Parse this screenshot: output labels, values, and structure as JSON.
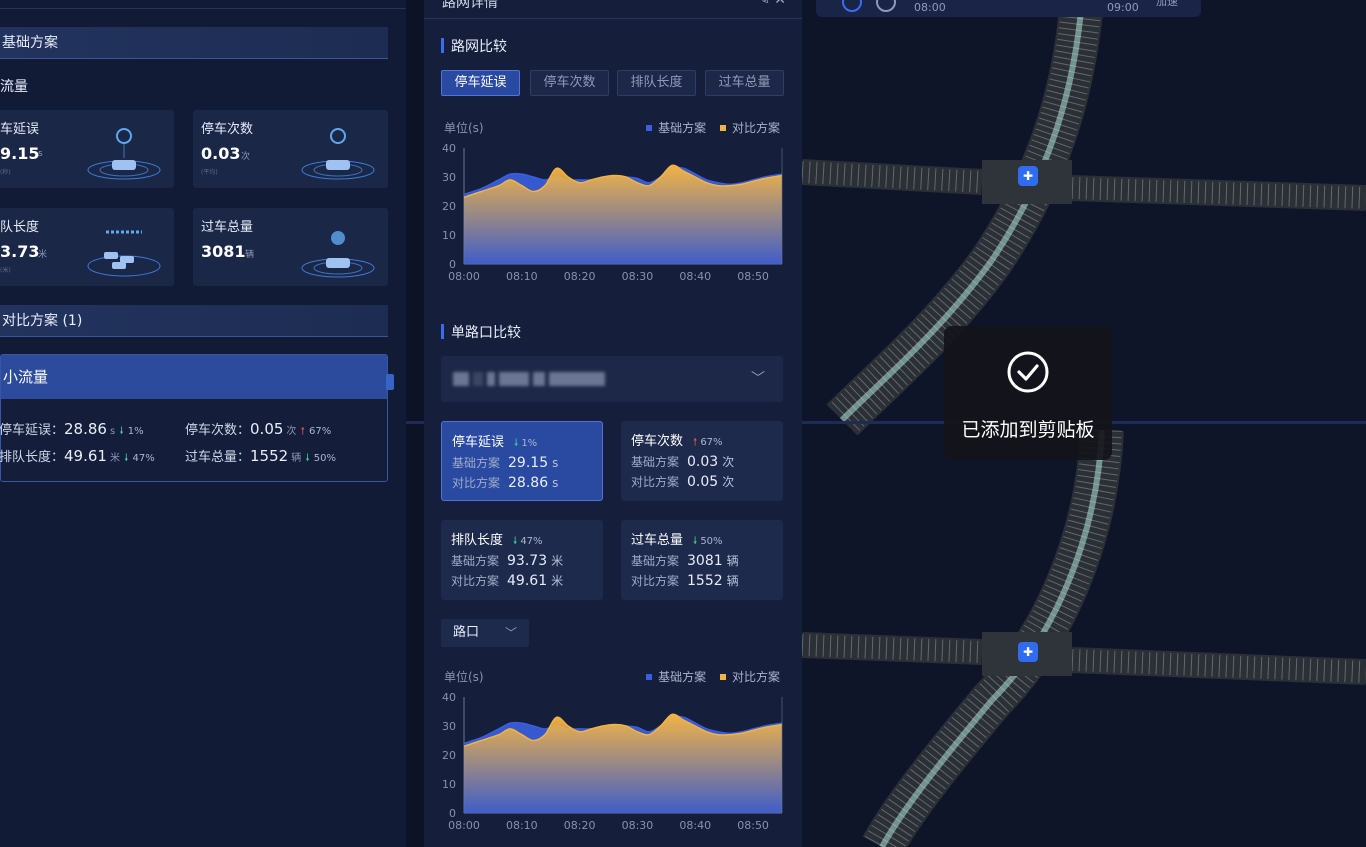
{
  "left_panel": {
    "base_section_title": "基础方案",
    "flow_title": "流量",
    "metrics": [
      {
        "label": "车延误",
        "value": "9.15",
        "unit": "s",
        "tiny": "(秒)"
      },
      {
        "label": "停车次数",
        "value": "0.03",
        "unit": "次",
        "tiny": "(平均)"
      },
      {
        "label": "队长度",
        "value": "3.73",
        "unit": "米",
        "tiny": "(米)"
      },
      {
        "label": "过车总量",
        "value": "3081",
        "unit": "辆",
        "tiny": ""
      }
    ],
    "compare_section_title": "对比方案 (1)",
    "plan_card": {
      "name": "小流量",
      "rows": [
        [
          {
            "label": "停车延误：",
            "value": "28.86",
            "unit": "s",
            "trend": "down",
            "pct": "1%"
          },
          {
            "label": "停车次数：",
            "value": "0.05",
            "unit": "次",
            "trend": "up",
            "pct": "67%"
          }
        ],
        [
          {
            "label": "排队长度：",
            "value": "49.61",
            "unit": "米",
            "trend": "down",
            "pct": "47%"
          },
          {
            "label": "过车总量：",
            "value": "1552",
            "unit": "辆",
            "trend": "down",
            "pct": "50%"
          }
        ]
      ]
    }
  },
  "mid_panel": {
    "header_title": "路网详情",
    "header_icons": "✎  ✕",
    "network_title": "路网比较",
    "tabs": [
      "停车延误",
      "停车次数",
      "排队长度",
      "过车总量"
    ],
    "active_tab": 0,
    "chart_unit": "单位(s)",
    "legend_base": "基础方案",
    "legend_compare": "对比方案",
    "single_title": "单路口比较",
    "compare_cards": [
      {
        "title": "停车延误",
        "trend": "down",
        "pct": "1%",
        "base_label": "基础方案",
        "base_value": "29.15",
        "base_unit": "s",
        "cmp_label": "对比方案",
        "cmp_value": "28.86",
        "cmp_unit": "s",
        "active": true
      },
      {
        "title": "停车次数",
        "trend": "up",
        "pct": "67%",
        "base_label": "基础方案",
        "base_value": "0.03",
        "base_unit": "次",
        "cmp_label": "对比方案",
        "cmp_value": "0.05",
        "cmp_unit": "次",
        "active": false
      },
      {
        "title": "排队长度",
        "trend": "down",
        "pct": "47%",
        "base_label": "基础方案",
        "base_value": "93.73",
        "base_unit": "米",
        "cmp_label": "对比方案",
        "cmp_value": "49.61",
        "cmp_unit": "米",
        "active": false
      },
      {
        "title": "过车总量",
        "trend": "down",
        "pct": "50%",
        "base_label": "基础方案",
        "base_value": "3081",
        "base_unit": "辆",
        "cmp_label": "对比方案",
        "cmp_value": "1552",
        "cmp_unit": "辆",
        "active": false
      }
    ],
    "junction_select": "路口"
  },
  "timeline": {
    "start": "08:00",
    "end": "09:00",
    "tail": "加速"
  },
  "toast": {
    "text": "已添加到剪贴板"
  },
  "colors": {
    "base": "#3a5fe0",
    "compare": "#f2b345",
    "accent": "#3a6cf0",
    "down": "#3fcf9a",
    "up": "#e0524e"
  },
  "chart_data": [
    {
      "type": "area",
      "title": "",
      "ylabel": "单位(s)",
      "xlabel": "",
      "x_ticks": [
        "08:00",
        "08:10",
        "08:20",
        "08:30",
        "08:40",
        "08:50"
      ],
      "y_ticks": [
        0,
        10,
        20,
        30,
        40
      ],
      "ylim": [
        0,
        40
      ],
      "x": [
        0,
        3,
        6,
        8,
        10,
        12,
        14,
        16,
        18,
        20,
        22,
        24,
        26,
        28,
        30,
        32,
        34,
        36,
        38,
        40,
        42,
        44,
        46,
        48,
        50,
        52,
        55
      ],
      "series": [
        {
          "name": "基础方案",
          "values": [
            24,
            26,
            29,
            31,
            31,
            30,
            29,
            30,
            29,
            29,
            29,
            29.5,
            30,
            30,
            29.5,
            28,
            30,
            33,
            33,
            31,
            29,
            28,
            27.5,
            28,
            29,
            30,
            31
          ]
        },
        {
          "name": "对比方案",
          "values": [
            23,
            25,
            27,
            29,
            27,
            25,
            27,
            33,
            30,
            28,
            29,
            30,
            30.5,
            30,
            28,
            27,
            30,
            34,
            32,
            30,
            28,
            27,
            27,
            27.5,
            28.5,
            29.5,
            30.5
          ]
        }
      ],
      "grid": false,
      "legend": "top-right"
    },
    {
      "type": "area",
      "title": "",
      "ylabel": "单位(s)",
      "xlabel": "",
      "x_ticks": [
        "08:00",
        "08:10",
        "08:20",
        "08:30",
        "08:40",
        "08:50"
      ],
      "y_ticks": [
        0,
        10,
        20,
        30,
        40
      ],
      "ylim": [
        0,
        40
      ],
      "x": [
        0,
        3,
        6,
        8,
        10,
        12,
        14,
        16,
        18,
        20,
        22,
        24,
        26,
        28,
        30,
        32,
        34,
        36,
        38,
        40,
        42,
        44,
        46,
        48,
        50,
        52,
        55
      ],
      "series": [
        {
          "name": "基础方案",
          "values": [
            24,
            26,
            29,
            31,
            31,
            30,
            29,
            30,
            29,
            29,
            29,
            29.5,
            30,
            30,
            29.5,
            28,
            30,
            33,
            33,
            31,
            29,
            28,
            27.5,
            28,
            29,
            30,
            31
          ]
        },
        {
          "name": "对比方案",
          "values": [
            23,
            25,
            27,
            29,
            27,
            25,
            27,
            33,
            30,
            28,
            29,
            30,
            30.5,
            30,
            28,
            27,
            30,
            34,
            32,
            30,
            28,
            27,
            27,
            27.5,
            28.5,
            29.5,
            30.5
          ]
        }
      ],
      "grid": false,
      "legend": "top-right"
    }
  ]
}
